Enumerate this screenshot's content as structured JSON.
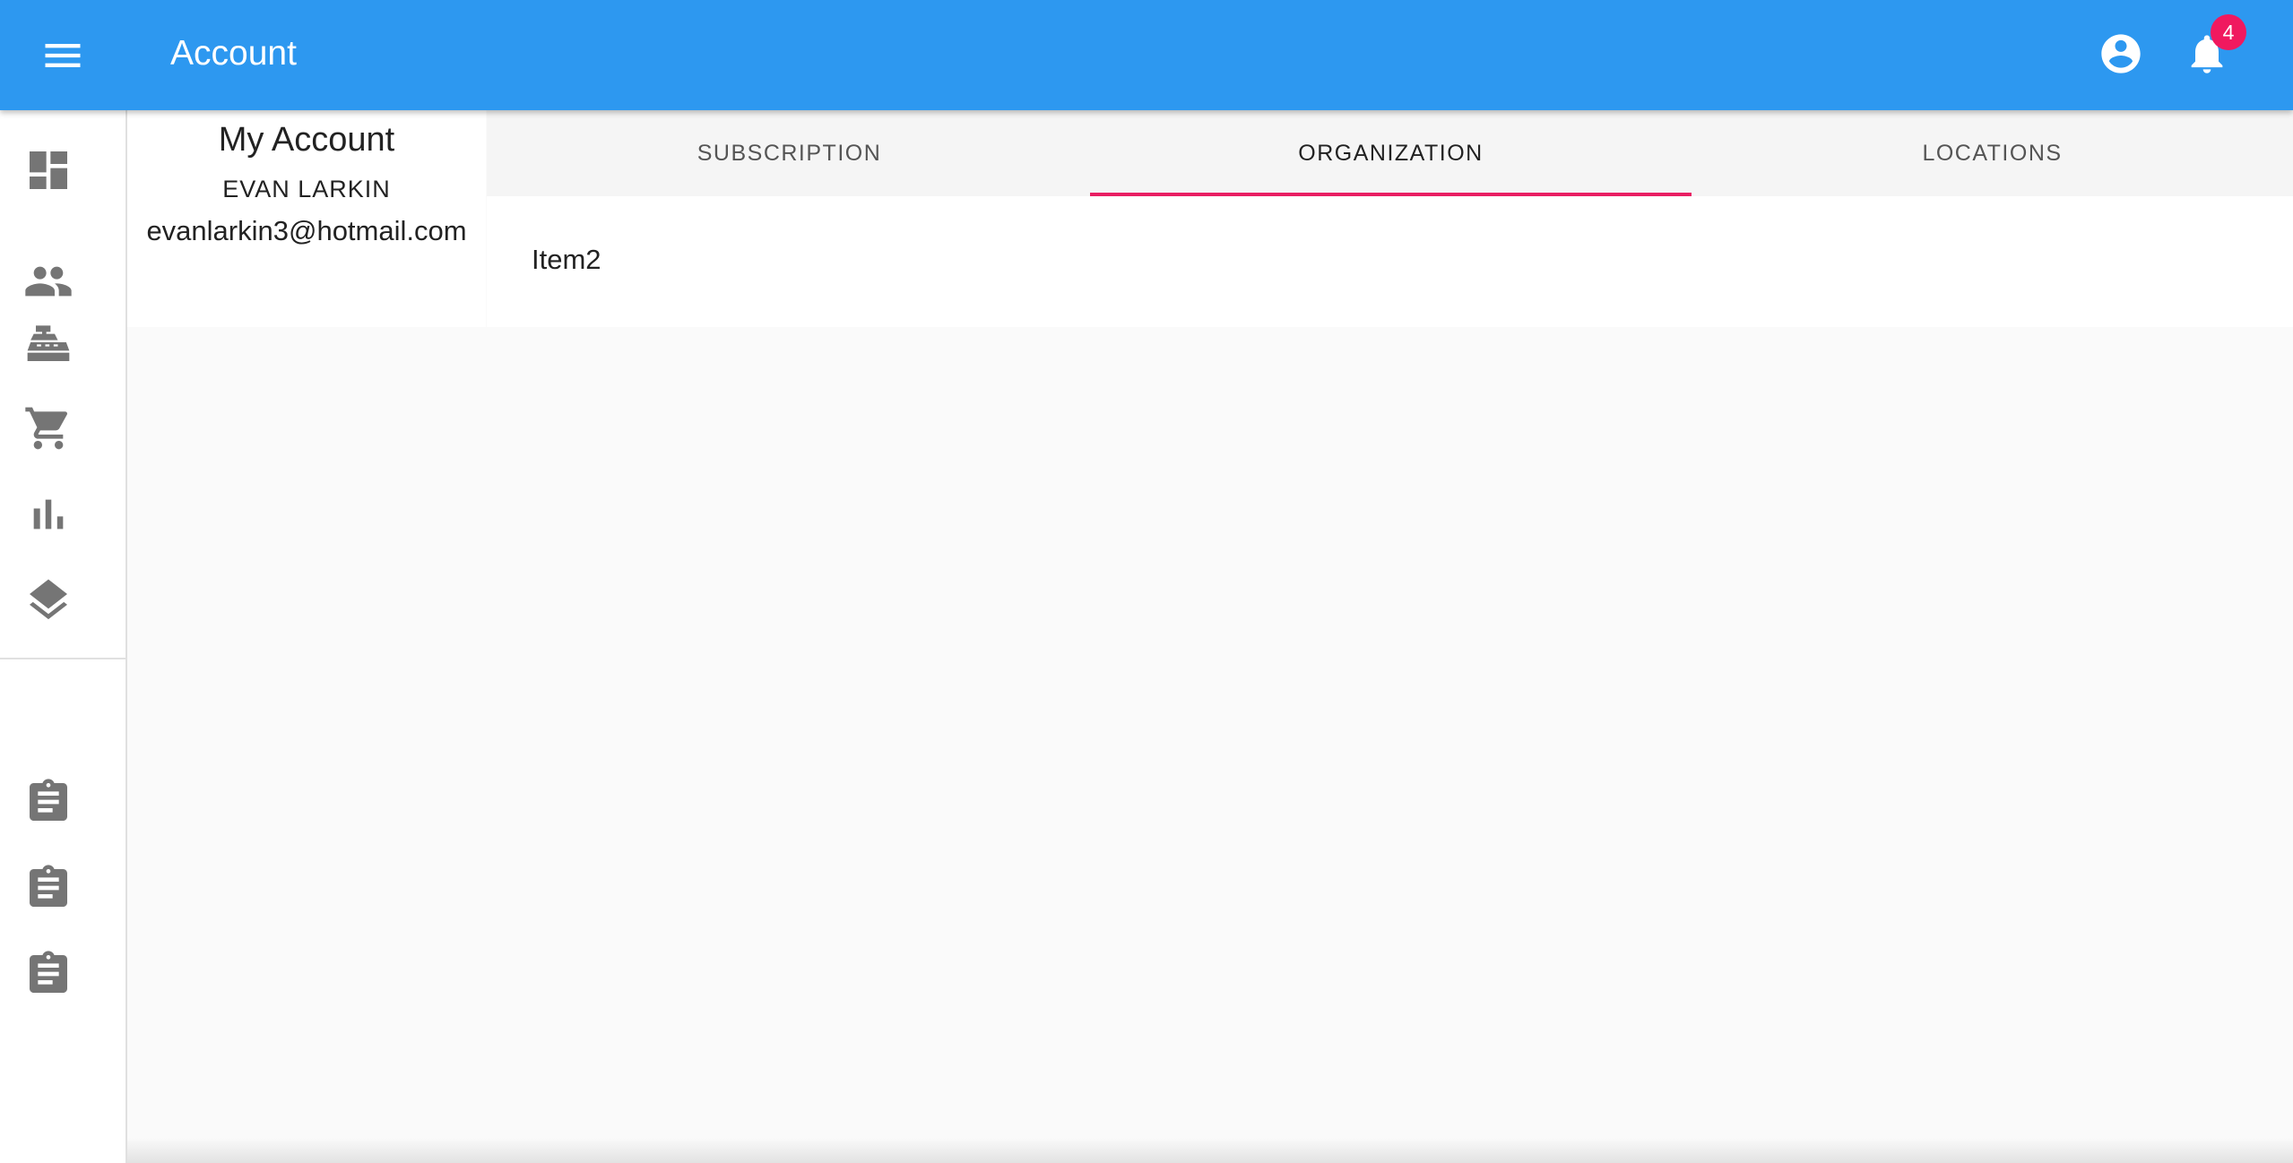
{
  "appbar": {
    "title": "Account",
    "notification_count": "4"
  },
  "sidebar": {
    "items": [
      {
        "icon": "dashboard-icon"
      },
      {
        "icon": "people-icon"
      },
      {
        "icon": "cash-register-icon"
      },
      {
        "icon": "shopping-cart-icon"
      },
      {
        "icon": "bar-chart-icon"
      },
      {
        "icon": "layers-icon"
      },
      {
        "icon": "clipboard-icon"
      },
      {
        "icon": "clipboard-icon"
      },
      {
        "icon": "clipboard-icon"
      }
    ]
  },
  "profile": {
    "heading": "My Account",
    "name": "EVAN LARKIN",
    "email": "evanlarkin3@hotmail.com"
  },
  "tabs": [
    {
      "label": "SUBSCRIPTION",
      "active": false
    },
    {
      "label": "ORGANIZATION",
      "active": true
    },
    {
      "label": "LOCATIONS",
      "active": false
    }
  ],
  "content": {
    "item": "Item2"
  },
  "colors": {
    "appbar": "#2d98f0",
    "badge": "#f0195f",
    "tab_indicator": "#e91e63",
    "icon": "#757575"
  }
}
